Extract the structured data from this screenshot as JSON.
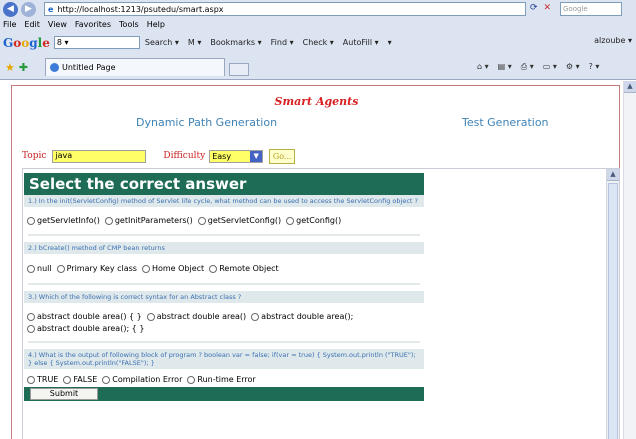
{
  "browser": {
    "address": "http://localhost:1213/psutedu/smart.aspx",
    "search_placeholder": "Google",
    "menu": [
      "File",
      "Edit",
      "View",
      "Favorites",
      "Tools",
      "Help"
    ],
    "google_bar": {
      "search_value": "8 ▾",
      "items": [
        "Search ▾",
        "M ▾",
        "Bookmarks ▾",
        "Find ▾",
        "Check ▾",
        "AutoFill ▾",
        "▾"
      ],
      "right_label": "alzoube ▾"
    },
    "tab_title": "Untitled Page"
  },
  "page": {
    "site_title": "Smart Agents",
    "nav": {
      "dynamic": "Dynamic Path Generation",
      "test": "Test Generation"
    },
    "topic": {
      "label": "Topic",
      "value": "java"
    },
    "difficulty": {
      "label": "Difficulty",
      "value": "Easy"
    },
    "go_label": "Go..."
  },
  "quiz": {
    "heading": "Select the correct answer",
    "questions": [
      {
        "text": "1.) In the init(ServletConfig) method of Servlet life cycle, what method can be used to access the ServletConfig object ?",
        "options": [
          "getServletInfo()",
          "getInitParameters()",
          "getServletConfig()",
          "getConfig()"
        ]
      },
      {
        "text": "2.) bCreate() method of CMP bean returns",
        "options": [
          "null",
          "Primary Key class",
          "Home Object",
          "Remote Object"
        ]
      },
      {
        "text": "3.) Which of the following is correct syntax for an Abstract class ?",
        "options": [
          "abstract double area() { }",
          "abstract double area()",
          "abstract double area();",
          "abstract double area(); { }"
        ]
      },
      {
        "text": "4.) What is the output of following block of program ? boolean var = false; if(var = true) { System.out.println (\"TRUE\"); } else { System.out.println(\"FALSE\"); }",
        "options": [
          "TRUE",
          "FALSE",
          "Compilation Error",
          "Run-time Error"
        ]
      }
    ],
    "submit_label": "Submit"
  }
}
